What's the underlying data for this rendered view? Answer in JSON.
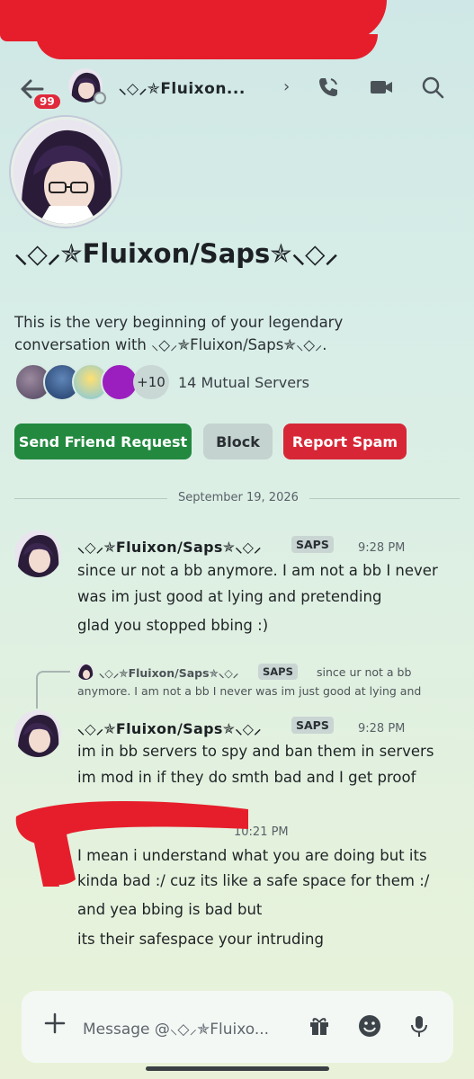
{
  "header": {
    "back_badge": "99",
    "name": "⸜◇⸝✯Fluixon...",
    "chevron": "›"
  },
  "profile": {
    "display_name": "⸜◇⸝✯Fluixon/Saps✯⸜◇⸝",
    "intro_line1": "This is the very beginning of your legendary",
    "intro_line2": "conversation with ⸜◇⸝✯Fluixon/Saps✯⸜◇⸝.",
    "mutual_more": "+10",
    "mutual_servers": "14 Mutual Servers"
  },
  "actions": {
    "send_friend_request": "Send Friend Request",
    "block": "Block",
    "report_spam": "Report Spam"
  },
  "date_divider": "September 19, 2026",
  "messages": [
    {
      "author": "⸜◇⸝✯Fluixon/Saps✯⸜◇⸝",
      "tag": "SAPS",
      "time": "9:28 PM",
      "lines": [
        "since ur not a bb anymore. I am not a bb I never",
        "was im just good at lying and pretending",
        "glad you stopped bbing :)"
      ]
    },
    {
      "reply_author": "⸜◇⸝✯Fluixon/Saps✯⸜◇⸝",
      "reply_tag": "SAPS",
      "reply_line1": "since ur not a bb",
      "reply_line2": "anymore. I am not a bb I never was im just good at lying and",
      "author": "⸜◇⸝✯Fluixon/Saps✯⸜◇⸝",
      "tag": "SAPS",
      "time": "9:28 PM",
      "lines": [
        "im in bb servers to spy and ban them in servers",
        "im mod in if they do smth bad and I get proof"
      ]
    },
    {
      "time": "10:21 PM",
      "lines": [
        "I mean i understand what you are doing but its",
        "kinda bad :/ cuz its like a safe space for them :/",
        "and yea bbing is bad but",
        "its their safespace your intruding"
      ]
    }
  ],
  "composer": {
    "placeholder": "Message @⸜◇⸝✯Fluixo..."
  },
  "colors": {
    "friend_green": "#22893f",
    "spam_red": "#d72736",
    "badge_red": "#e0293b"
  }
}
